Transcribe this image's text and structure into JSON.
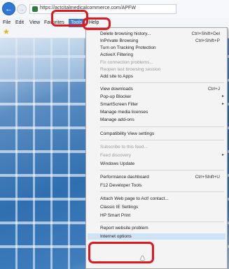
{
  "browser": {
    "url": "https://actcitalmedicalcommerce.com/APFW"
  },
  "menubar": {
    "items": [
      "File",
      "Edit",
      "View",
      "Favorites",
      "Tools",
      "Help"
    ],
    "active": "Tools"
  },
  "tools_menu": {
    "items": [
      {
        "label": "Delete browsing history...",
        "shortcut": "Ctrl+Shift+Del",
        "disabled": false
      },
      {
        "label": "InPrivate Browsing",
        "shortcut": "Ctrl+Shift+P",
        "disabled": false
      },
      {
        "label": "Turn on Tracking Protection",
        "shortcut": "",
        "disabled": false
      },
      {
        "label": "ActiveX Filtering",
        "shortcut": "",
        "disabled": false
      },
      {
        "label": "Fix connection problems...",
        "shortcut": "",
        "disabled": true
      },
      {
        "label": "Reopen last browsing session",
        "shortcut": "",
        "disabled": true
      },
      {
        "label": "Add site to Apps",
        "shortcut": "",
        "disabled": false
      },
      {
        "label": "View downloads",
        "shortcut": "Ctrl+J",
        "disabled": false
      },
      {
        "label": "Pop-up Blocker",
        "shortcut": "",
        "disabled": false,
        "submenu": true
      },
      {
        "label": "SmartScreen Filter",
        "shortcut": "",
        "disabled": false,
        "submenu": true
      },
      {
        "label": "Manage media licenses",
        "shortcut": "",
        "disabled": false
      },
      {
        "label": "Manage add-ons",
        "shortcut": "",
        "disabled": false
      },
      {
        "label": "Compatibility View settings",
        "shortcut": "",
        "disabled": false
      },
      {
        "label": "Subscribe to this feed...",
        "shortcut": "",
        "disabled": true
      },
      {
        "label": "Feed discovery",
        "shortcut": "",
        "disabled": true,
        "submenu": true
      },
      {
        "label": "Windows Update",
        "shortcut": "",
        "disabled": false
      },
      {
        "label": "Performance dashboard",
        "shortcut": "Ctrl+Shift+U",
        "disabled": false
      },
      {
        "label": "F12 Developer Tools",
        "shortcut": "",
        "disabled": false
      },
      {
        "label": "Attach Web page to Act! contact...",
        "shortcut": "",
        "disabled": false
      },
      {
        "label": "Classic IE Settings",
        "shortcut": "",
        "disabled": false
      },
      {
        "label": "HP Smart Print",
        "shortcut": "",
        "disabled": false
      },
      {
        "label": "Report website problem",
        "shortcut": "",
        "disabled": false
      },
      {
        "label": "Internet options",
        "shortcut": "",
        "disabled": false,
        "highlighted": true
      }
    ]
  },
  "colors": {
    "highlight_box": "#e0191e",
    "menu_active": "#3d7fd3",
    "menu_hover": "#cfe3f7"
  },
  "icons": [
    "back-arrow-icon",
    "forward-arrow-icon",
    "site-lock-icon",
    "favorites-star-icon",
    "submenu-arrow-icon",
    "mouse-cursor-icon"
  ]
}
